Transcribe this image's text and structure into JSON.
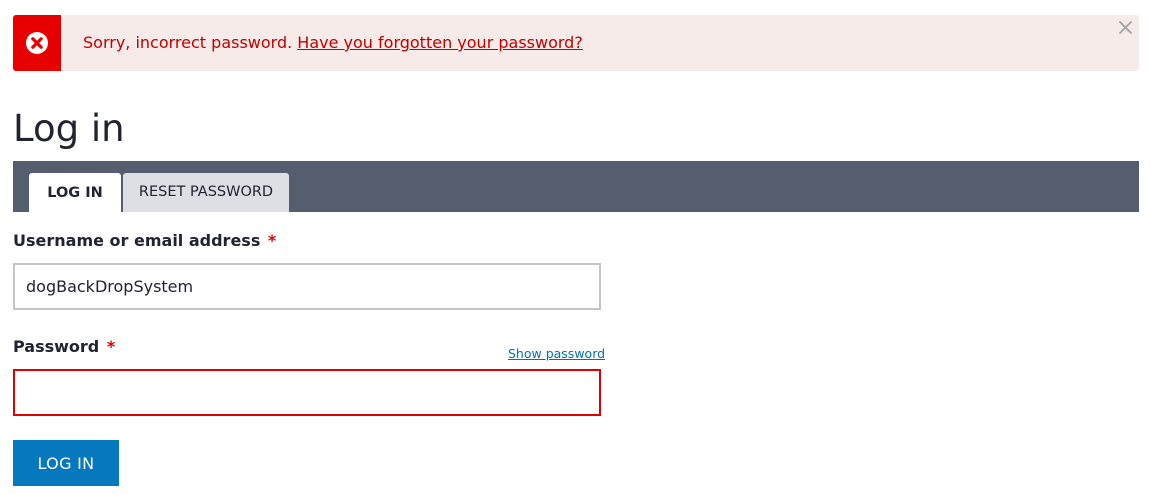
{
  "message": {
    "type": "error",
    "text": "Sorry, incorrect password.",
    "link_text": "Have you forgotten your password?",
    "icon": "error-x-circle-icon",
    "close_icon": "close-icon",
    "colors": {
      "accent": "#e60000",
      "background": "#f7ebe9",
      "text": "#c20000"
    }
  },
  "page": {
    "title": "Log in"
  },
  "tabs": [
    {
      "label": "LOG IN",
      "active": true
    },
    {
      "label": "RESET PASSWORD",
      "active": false
    }
  ],
  "form": {
    "username": {
      "label": "Username or email address",
      "required_marker": "*",
      "value": "dogBackDropSystem"
    },
    "password": {
      "label": "Password",
      "required_marker": "*",
      "value": "",
      "show_toggle_label": "Show password",
      "error": true
    },
    "submit_label": "LOG IN"
  },
  "colors": {
    "tab_bar": "#545e6f",
    "primary_button": "#0678be",
    "link": "#0071b8",
    "error_border": "#e00000"
  }
}
